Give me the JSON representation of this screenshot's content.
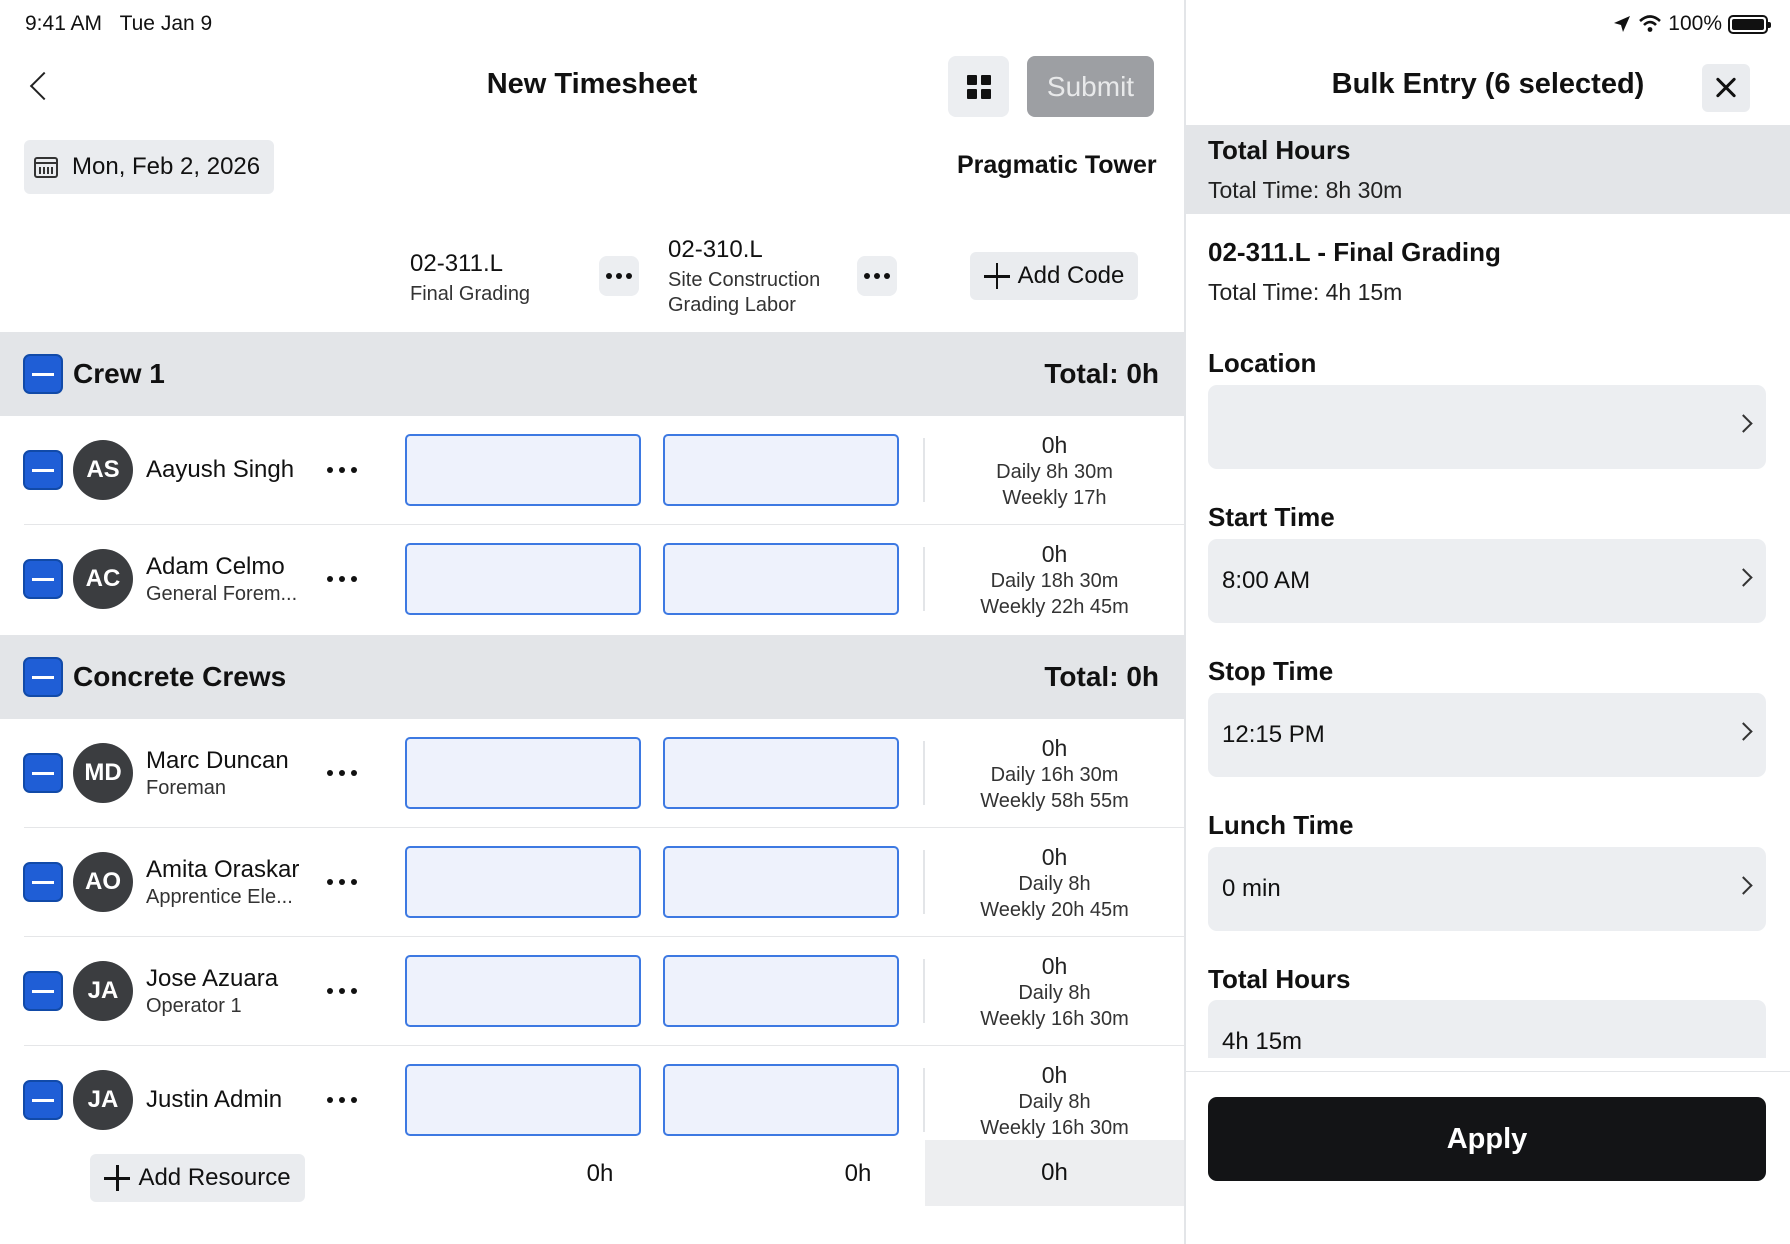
{
  "status_bar": {
    "time": "9:41 AM",
    "date": "Tue Jan 9",
    "battery": "100%"
  },
  "header": {
    "title": "New Timesheet",
    "submit_label": "Submit"
  },
  "date": "Mon, Feb 2, 2026",
  "project": "Pragmatic Tower",
  "codes": [
    {
      "id": "02-311.L",
      "name_line1": "Final Grading",
      "name_line2": ""
    },
    {
      "id": "02-310.L",
      "name_line1": "Site Construction",
      "name_line2": "Grading Labor"
    }
  ],
  "add_code_label": "Add Code",
  "groups": [
    {
      "name": "Crew 1",
      "total": "Total: 0h"
    },
    {
      "name": "Concrete Crews",
      "total": "Total: 0h"
    }
  ],
  "resources": [
    {
      "initials": "AS",
      "name": "Aayush Singh",
      "role": "",
      "hours": "0h",
      "daily": "Daily 8h 30m",
      "weekly": "Weekly 17h"
    },
    {
      "initials": "AC",
      "name": "Adam Celmo",
      "role": "General Forem...",
      "hours": "0h",
      "daily": "Daily 18h 30m",
      "weekly": "Weekly 22h 45m"
    },
    {
      "initials": "MD",
      "name": "Marc Duncan",
      "role": "Foreman",
      "hours": "0h",
      "daily": "Daily 16h 30m",
      "weekly": "Weekly 58h 55m"
    },
    {
      "initials": "AO",
      "name": "Amita Oraskar",
      "role": "Apprentice Ele...",
      "hours": "0h",
      "daily": "Daily 8h",
      "weekly": "Weekly 20h 45m"
    },
    {
      "initials": "JA",
      "name": "Jose Azuara",
      "role": "Operator 1",
      "hours": "0h",
      "daily": "Daily 8h",
      "weekly": "Weekly 16h 30m"
    },
    {
      "initials": "JA",
      "name": "Justin Admin",
      "role": "",
      "hours": "0h",
      "daily": "Daily 8h",
      "weekly": "Weekly 16h 30m"
    }
  ],
  "add_resource_label": "Add Resource",
  "footer_totals": [
    "0h",
    "0h",
    "0h"
  ],
  "bulk_panel": {
    "title": "Bulk Entry (6 selected)",
    "total_hours_heading": "Total Hours",
    "total_time": "Total Time: 8h 30m",
    "code_heading": "02-311.L - Final Grading",
    "code_total_time": "Total Time: 4h 15m",
    "location_label": "Location",
    "location_value": "",
    "start_label": "Start Time",
    "start_value": "8:00 AM",
    "stop_label": "Stop Time",
    "stop_value": "12:15 PM",
    "lunch_label": "Lunch Time",
    "lunch_value": "0 min",
    "hours_label": "Total Hours",
    "hours_value": "4h 15m",
    "apply_label": "Apply"
  },
  "colors": {
    "accent": "#1f5ed6",
    "cell_border": "#3d79e2",
    "group_bg": "#e3e5e8",
    "apply_bg": "#131416"
  }
}
